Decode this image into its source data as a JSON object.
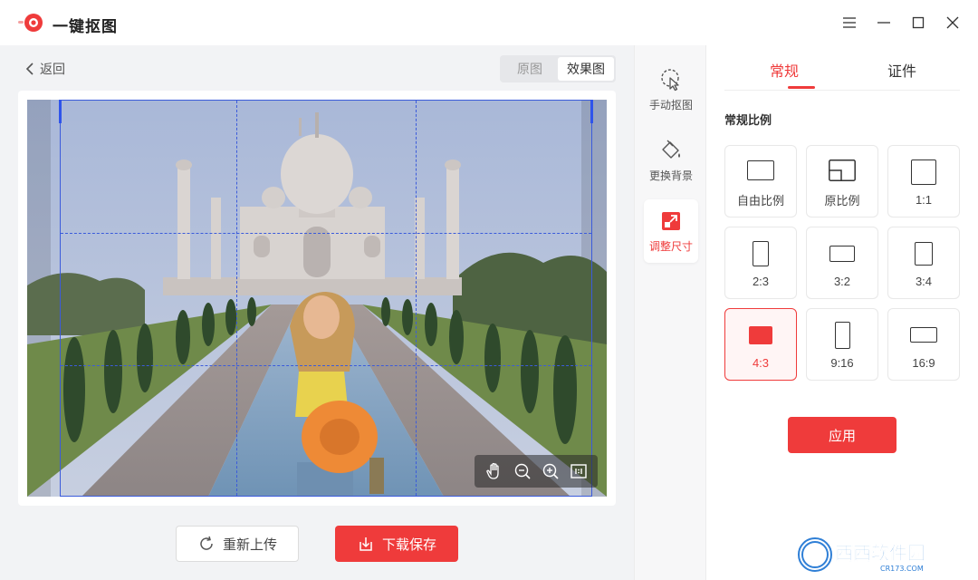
{
  "app": {
    "title": "一键抠图"
  },
  "window": {
    "controls": [
      "menu-icon",
      "minimize-icon",
      "maximize-icon",
      "close-icon"
    ]
  },
  "workarea": {
    "back_label": "返回",
    "view_toggle": {
      "options": [
        "原图",
        "效果图"
      ],
      "selected": "效果图"
    }
  },
  "actions": {
    "reupload_label": "重新上传",
    "download_label": "下载保存"
  },
  "tools": [
    {
      "label": "手动抠图",
      "icon": "lasso-cursor-icon"
    },
    {
      "label": "更换背景",
      "icon": "paint-bucket-icon"
    },
    {
      "label": "调整尺寸",
      "icon": "resize-icon",
      "active": true
    }
  ],
  "zoom_tools": [
    "hand-icon",
    "zoom-out-icon",
    "zoom-in-icon",
    "actual-size-icon"
  ],
  "panel": {
    "tabs": [
      "常规",
      "证件"
    ],
    "active_tab": "常规",
    "section_title": "常规比例",
    "ratios": [
      {
        "label": "自由比例"
      },
      {
        "label": "原比例"
      },
      {
        "label": "1:1"
      },
      {
        "label": "2:3"
      },
      {
        "label": "3:2"
      },
      {
        "label": "3:4"
      },
      {
        "label": "4:3",
        "selected": true
      },
      {
        "label": "9:16"
      },
      {
        "label": "16:9"
      }
    ],
    "apply_label": "应用"
  },
  "watermark": {
    "text": "西西软件园",
    "sub": "CR173.COM"
  },
  "colors": {
    "accent": "#ef3b3b",
    "crop_line": "#3b5bdb"
  }
}
